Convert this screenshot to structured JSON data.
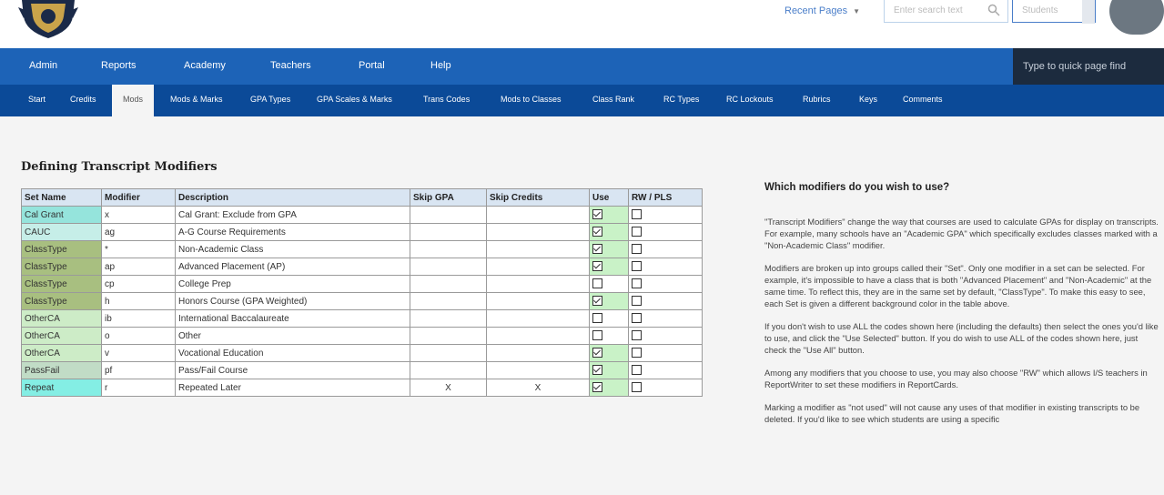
{
  "header": {
    "recent_pages": "Recent Pages",
    "search_placeholder": "Enter search text",
    "search_scope": "Students"
  },
  "main_nav": {
    "items": [
      "Admin",
      "Reports",
      "Academy",
      "Teachers",
      "Portal",
      "Help"
    ],
    "quick_find": "Type to quick page find"
  },
  "sub_nav": {
    "items": [
      "Start",
      "Credits",
      "Mods",
      "Mods & Marks",
      "GPA Types",
      "GPA Scales & Marks",
      "Trans Codes",
      "Mods to Classes",
      "Class Rank",
      "RC Types",
      "RC Lockouts",
      "Rubrics",
      "Keys",
      "Comments"
    ],
    "active": "Mods"
  },
  "page": {
    "title": "Defining Transcript Modifiers"
  },
  "table": {
    "headers": [
      "Set Name",
      "Modifier",
      "Description",
      "Skip GPA",
      "Skip Credits",
      "Use",
      "RW / PLS"
    ],
    "set_colors": {
      "Cal Grant": "#95e4dc",
      "CAUC": "#c6eee8",
      "ClassType": "#a8bf80",
      "OtherCA": "#cdecc7",
      "PassFail": "#c1dcc6",
      "Repeat": "#84eee4"
    },
    "rows": [
      {
        "set": "Cal Grant",
        "modifier": "x",
        "description": "Cal Grant: Exclude from GPA",
        "skip_gpa": "",
        "skip_credits": "",
        "use": true,
        "rw": false
      },
      {
        "set": "CAUC",
        "modifier": "ag",
        "description": "A-G Course Requirements",
        "skip_gpa": "",
        "skip_credits": "",
        "use": true,
        "rw": false
      },
      {
        "set": "ClassType",
        "modifier": "*",
        "description": "Non-Academic Class",
        "skip_gpa": "",
        "skip_credits": "",
        "use": true,
        "rw": false
      },
      {
        "set": "ClassType",
        "modifier": "ap",
        "description": "Advanced Placement (AP)",
        "skip_gpa": "",
        "skip_credits": "",
        "use": true,
        "rw": false
      },
      {
        "set": "ClassType",
        "modifier": "cp",
        "description": "College Prep",
        "skip_gpa": "",
        "skip_credits": "",
        "use": false,
        "rw": false
      },
      {
        "set": "ClassType",
        "modifier": "h",
        "description": "Honors Course (GPA Weighted)",
        "skip_gpa": "",
        "skip_credits": "",
        "use": true,
        "rw": false
      },
      {
        "set": "OtherCA",
        "modifier": "ib",
        "description": "International Baccalaureate",
        "skip_gpa": "",
        "skip_credits": "",
        "use": false,
        "rw": false
      },
      {
        "set": "OtherCA",
        "modifier": "o",
        "description": "Other",
        "skip_gpa": "",
        "skip_credits": "",
        "use": false,
        "rw": false
      },
      {
        "set": "OtherCA",
        "modifier": "v",
        "description": "Vocational Education",
        "skip_gpa": "",
        "skip_credits": "",
        "use": true,
        "rw": false
      },
      {
        "set": "PassFail",
        "modifier": "pf",
        "description": "Pass/Fail Course",
        "skip_gpa": "",
        "skip_credits": "",
        "use": true,
        "rw": false
      },
      {
        "set": "Repeat",
        "modifier": "r",
        "description": "Repeated Later",
        "skip_gpa": "X",
        "skip_credits": "X",
        "use": true,
        "rw": false
      }
    ]
  },
  "help": {
    "heading": "Which modifiers do you wish to use?",
    "paragraphs": [
      "\"Transcript Modifiers\" change the way that courses are used to calculate GPAs for display on transcripts. For example, many schools have an \"Academic GPA\" which specifically excludes classes marked with a \"Non-Academic Class\" modifier.",
      "Modifiers are broken up into groups called their \"Set\". Only one modifier in a set can be selected. For example, it's impossible to have a class that is both \"Advanced Placement\" and \"Non-Academic\" at the same time. To reflect this, they are in the same set by default, \"ClassType\". To make this easy to see, each Set is given a different background color in the table above.",
      "If you don't wish to use ALL the codes shown here (including the defaults) then select the ones you'd like to use, and click the \"Use Selected\" button. If you do wish to use ALL of the codes shown here, just check the \"Use All\" button.",
      "Among any modifiers that you choose to use, you may also choose \"RW\" which allows I/S teachers in ReportWriter to set these modifiers in ReportCards.",
      "Marking a modifier as \"not used\" will not cause any uses of that modifier in existing transcripts to be deleted. If you'd like to see which students are using a specific"
    ]
  }
}
